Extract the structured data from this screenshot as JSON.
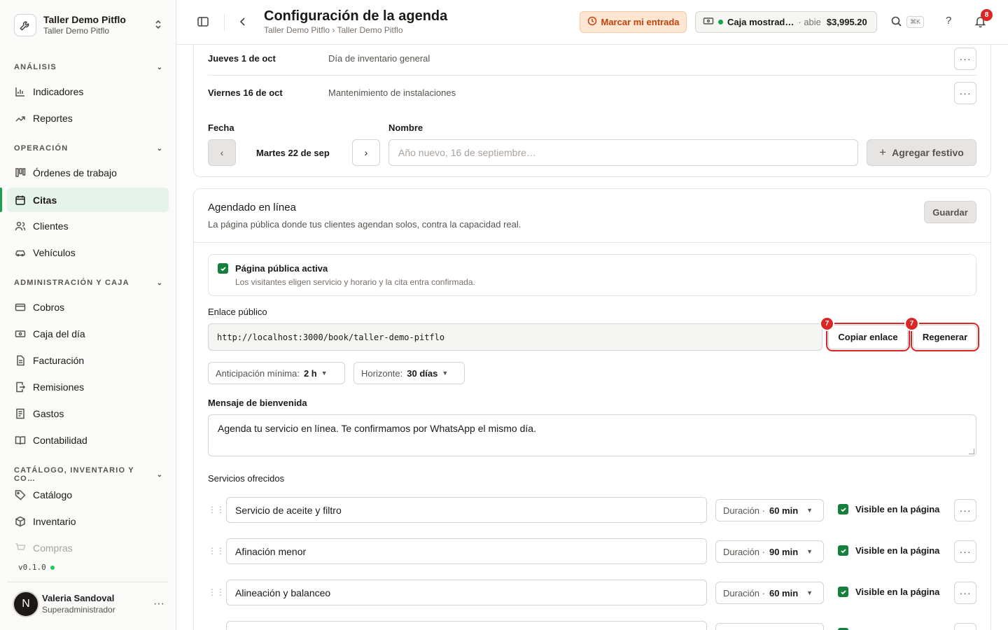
{
  "workspace": {
    "name": "Taller Demo Pitflo",
    "subtitle": "Taller Demo Pitflo"
  },
  "sidebar": {
    "sections": [
      {
        "title": "ANÁLISIS",
        "items": [
          "Indicadores",
          "Reportes"
        ]
      },
      {
        "title": "OPERACIÓN",
        "items": [
          "Órdenes de trabajo",
          "Citas",
          "Clientes",
          "Vehículos"
        ]
      },
      {
        "title": "ADMINISTRACIÓN Y CAJA",
        "items": [
          "Cobros",
          "Caja del día",
          "Facturación",
          "Remisiones",
          "Gastos",
          "Contabilidad"
        ]
      },
      {
        "title": "CATÁLOGO, INVENTARIO Y CO…",
        "items": [
          "Catálogo",
          "Inventario",
          "Compras"
        ]
      }
    ],
    "active_item": "Citas",
    "version": "v0.1.0",
    "user": {
      "initial": "N",
      "name": "Valeria Sandoval",
      "role": "Superadministrador"
    }
  },
  "header": {
    "title": "Configuración de la agenda",
    "breadcrumb": "Taller Demo Pitflo › Taller Demo Pitflo",
    "clock_in": "Marcar mi entrada",
    "cash": {
      "name": "Caja mostrad…",
      "status": "· abie",
      "amount": "$3,995.20"
    },
    "search_shortcut": "⌘K",
    "help": "?",
    "notifications": "8"
  },
  "holidays": {
    "rows": [
      {
        "date": "Jueves 1 de oct",
        "name": "Día de inventario general"
      },
      {
        "date": "Viernes 16 de oct",
        "name": "Mantenimiento de instalaciones"
      }
    ],
    "date_label": "Fecha",
    "name_label": "Nombre",
    "prev": "‹",
    "next": "›",
    "selected_date": "Martes 22 de sep",
    "name_placeholder": "Año nuevo, 16 de septiembre…",
    "add_label": "Agregar festivo",
    "add_icon": "+"
  },
  "online": {
    "title": "Agendado en línea",
    "subtitle": "La página pública donde tus clientes agendan solos, contra la capacidad real.",
    "save": "Guardar",
    "public_title": "Página pública activa",
    "public_sub": "Los visitantes eligen servicio y horario y la cita entra confirmada.",
    "link_label": "Enlace público",
    "link": "http://localhost:3000/book/taller-demo-pitflo",
    "copy": "Copiar enlace",
    "regen": "Regenerar",
    "marker": "7",
    "min_notice_label": "Anticipación mínima:",
    "min_notice_value": "2 h",
    "horizon_label": "Horizonte:",
    "horizon_value": "30 días",
    "welcome_label": "Mensaje de bienvenida",
    "welcome": "Agenda tu servicio en línea. Te confirmamos por WhatsApp el mismo día.",
    "services_label": "Servicios ofrecidos",
    "duration_label": "Duración ·",
    "visible_label": "Visible en la página",
    "services": [
      {
        "name": "Servicio de aceite y filtro",
        "duration": "60 min"
      },
      {
        "name": "Afinación menor",
        "duration": "90 min"
      },
      {
        "name": "Alineación y balanceo",
        "duration": "60 min"
      }
    ]
  },
  "colors": {
    "accent": "#15803d",
    "highlight": "#dc2626",
    "clockin_bg": "#fde7d3",
    "clockin_text": "#c2410c"
  }
}
